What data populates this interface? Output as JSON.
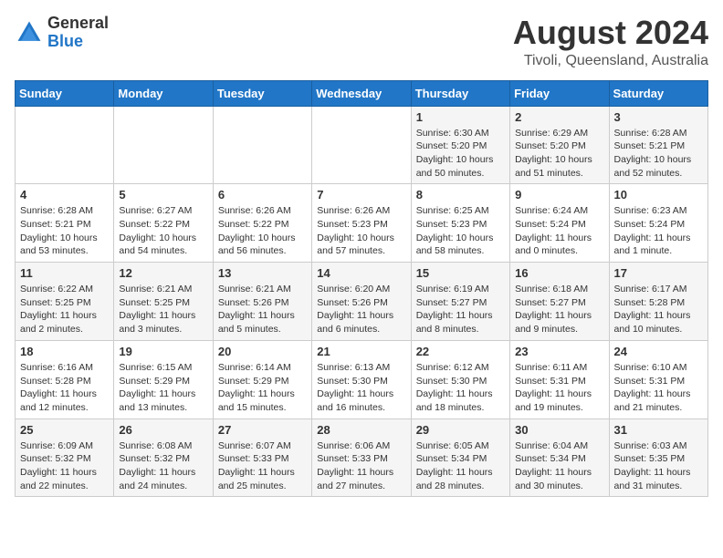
{
  "header": {
    "logo_general": "General",
    "logo_blue": "Blue",
    "month_year": "August 2024",
    "location": "Tivoli, Queensland, Australia"
  },
  "days_of_week": [
    "Sunday",
    "Monday",
    "Tuesday",
    "Wednesday",
    "Thursday",
    "Friday",
    "Saturday"
  ],
  "weeks": [
    [
      {
        "day": "",
        "info": ""
      },
      {
        "day": "",
        "info": ""
      },
      {
        "day": "",
        "info": ""
      },
      {
        "day": "",
        "info": ""
      },
      {
        "day": "1",
        "info": "Sunrise: 6:30 AM\nSunset: 5:20 PM\nDaylight: 10 hours\nand 50 minutes."
      },
      {
        "day": "2",
        "info": "Sunrise: 6:29 AM\nSunset: 5:20 PM\nDaylight: 10 hours\nand 51 minutes."
      },
      {
        "day": "3",
        "info": "Sunrise: 6:28 AM\nSunset: 5:21 PM\nDaylight: 10 hours\nand 52 minutes."
      }
    ],
    [
      {
        "day": "4",
        "info": "Sunrise: 6:28 AM\nSunset: 5:21 PM\nDaylight: 10 hours\nand 53 minutes."
      },
      {
        "day": "5",
        "info": "Sunrise: 6:27 AM\nSunset: 5:22 PM\nDaylight: 10 hours\nand 54 minutes."
      },
      {
        "day": "6",
        "info": "Sunrise: 6:26 AM\nSunset: 5:22 PM\nDaylight: 10 hours\nand 56 minutes."
      },
      {
        "day": "7",
        "info": "Sunrise: 6:26 AM\nSunset: 5:23 PM\nDaylight: 10 hours\nand 57 minutes."
      },
      {
        "day": "8",
        "info": "Sunrise: 6:25 AM\nSunset: 5:23 PM\nDaylight: 10 hours\nand 58 minutes."
      },
      {
        "day": "9",
        "info": "Sunrise: 6:24 AM\nSunset: 5:24 PM\nDaylight: 11 hours\nand 0 minutes."
      },
      {
        "day": "10",
        "info": "Sunrise: 6:23 AM\nSunset: 5:24 PM\nDaylight: 11 hours\nand 1 minute."
      }
    ],
    [
      {
        "day": "11",
        "info": "Sunrise: 6:22 AM\nSunset: 5:25 PM\nDaylight: 11 hours\nand 2 minutes."
      },
      {
        "day": "12",
        "info": "Sunrise: 6:21 AM\nSunset: 5:25 PM\nDaylight: 11 hours\nand 3 minutes."
      },
      {
        "day": "13",
        "info": "Sunrise: 6:21 AM\nSunset: 5:26 PM\nDaylight: 11 hours\nand 5 minutes."
      },
      {
        "day": "14",
        "info": "Sunrise: 6:20 AM\nSunset: 5:26 PM\nDaylight: 11 hours\nand 6 minutes."
      },
      {
        "day": "15",
        "info": "Sunrise: 6:19 AM\nSunset: 5:27 PM\nDaylight: 11 hours\nand 8 minutes."
      },
      {
        "day": "16",
        "info": "Sunrise: 6:18 AM\nSunset: 5:27 PM\nDaylight: 11 hours\nand 9 minutes."
      },
      {
        "day": "17",
        "info": "Sunrise: 6:17 AM\nSunset: 5:28 PM\nDaylight: 11 hours\nand 10 minutes."
      }
    ],
    [
      {
        "day": "18",
        "info": "Sunrise: 6:16 AM\nSunset: 5:28 PM\nDaylight: 11 hours\nand 12 minutes."
      },
      {
        "day": "19",
        "info": "Sunrise: 6:15 AM\nSunset: 5:29 PM\nDaylight: 11 hours\nand 13 minutes."
      },
      {
        "day": "20",
        "info": "Sunrise: 6:14 AM\nSunset: 5:29 PM\nDaylight: 11 hours\nand 15 minutes."
      },
      {
        "day": "21",
        "info": "Sunrise: 6:13 AM\nSunset: 5:30 PM\nDaylight: 11 hours\nand 16 minutes."
      },
      {
        "day": "22",
        "info": "Sunrise: 6:12 AM\nSunset: 5:30 PM\nDaylight: 11 hours\nand 18 minutes."
      },
      {
        "day": "23",
        "info": "Sunrise: 6:11 AM\nSunset: 5:31 PM\nDaylight: 11 hours\nand 19 minutes."
      },
      {
        "day": "24",
        "info": "Sunrise: 6:10 AM\nSunset: 5:31 PM\nDaylight: 11 hours\nand 21 minutes."
      }
    ],
    [
      {
        "day": "25",
        "info": "Sunrise: 6:09 AM\nSunset: 5:32 PM\nDaylight: 11 hours\nand 22 minutes."
      },
      {
        "day": "26",
        "info": "Sunrise: 6:08 AM\nSunset: 5:32 PM\nDaylight: 11 hours\nand 24 minutes."
      },
      {
        "day": "27",
        "info": "Sunrise: 6:07 AM\nSunset: 5:33 PM\nDaylight: 11 hours\nand 25 minutes."
      },
      {
        "day": "28",
        "info": "Sunrise: 6:06 AM\nSunset: 5:33 PM\nDaylight: 11 hours\nand 27 minutes."
      },
      {
        "day": "29",
        "info": "Sunrise: 6:05 AM\nSunset: 5:34 PM\nDaylight: 11 hours\nand 28 minutes."
      },
      {
        "day": "30",
        "info": "Sunrise: 6:04 AM\nSunset: 5:34 PM\nDaylight: 11 hours\nand 30 minutes."
      },
      {
        "day": "31",
        "info": "Sunrise: 6:03 AM\nSunset: 5:35 PM\nDaylight: 11 hours\nand 31 minutes."
      }
    ]
  ]
}
